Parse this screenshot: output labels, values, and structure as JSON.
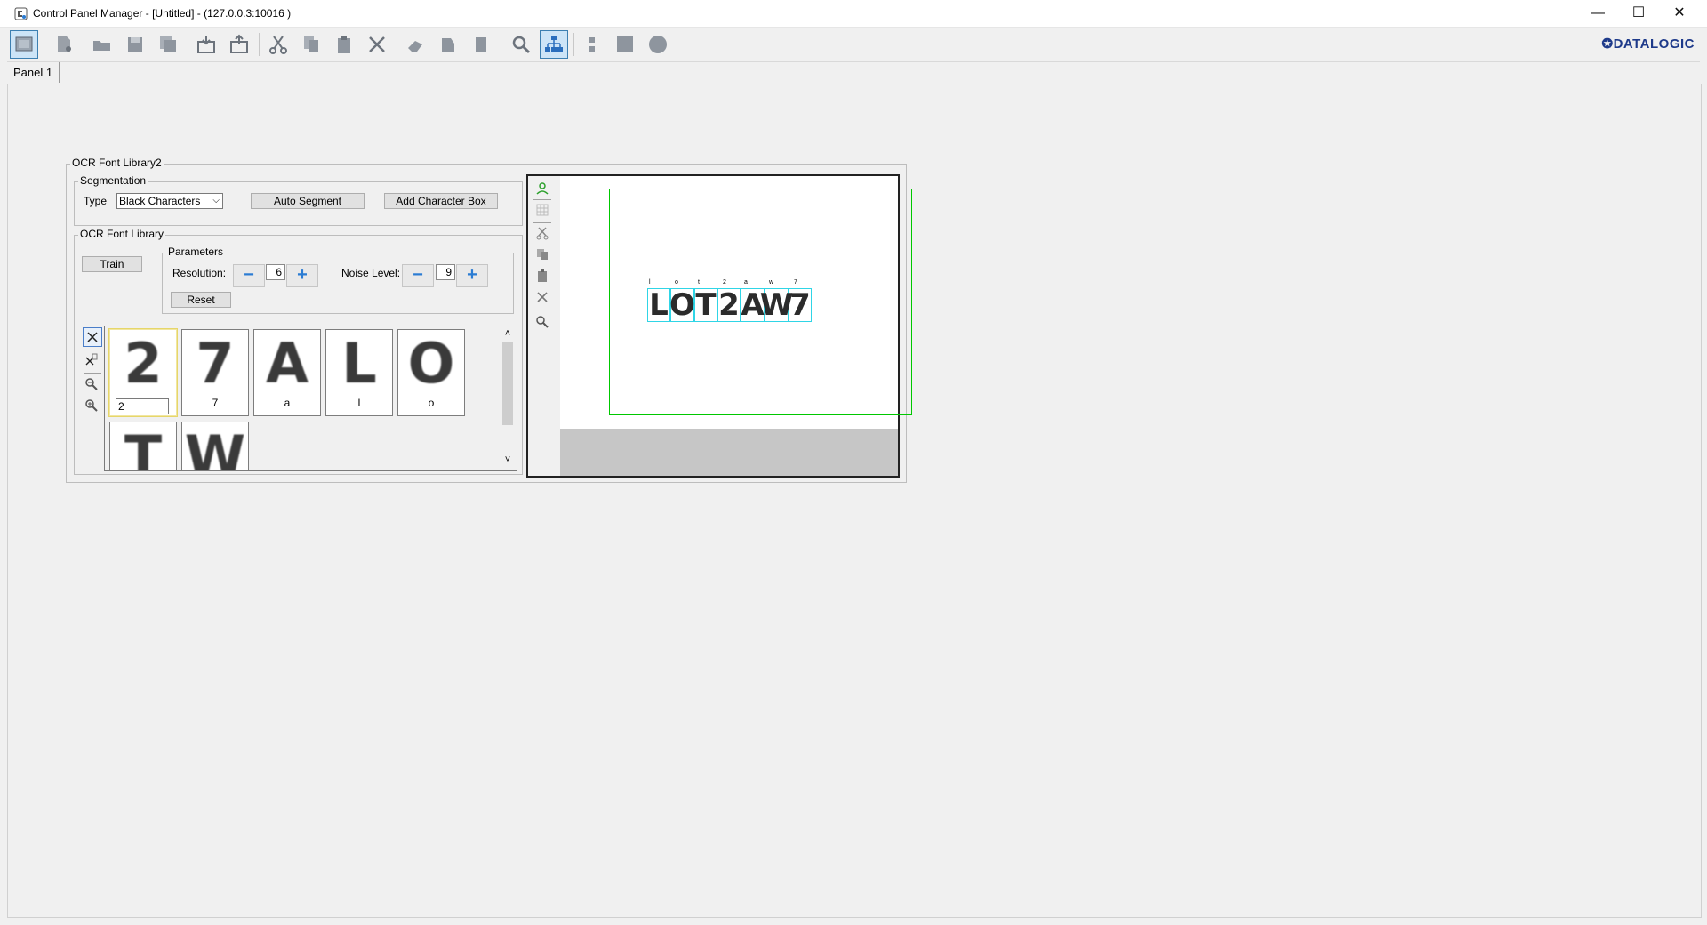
{
  "window": {
    "title": "Control Panel Manager - [Untitled] - (127.0.0.3:10016 )",
    "minimize": "—",
    "maximize": "☐",
    "close": "✕"
  },
  "brand": {
    "logo": "DATALOGIC",
    "logo_mark": "✪"
  },
  "toolbar": {
    "items": [
      "select-tool",
      "new-panel",
      "open",
      "save",
      "save-all",
      "import",
      "export",
      "cut",
      "copy",
      "paste",
      "delete",
      "align-left",
      "align-right",
      "align-bottom",
      "zoom",
      "hierarchy",
      "stack",
      "rectangle",
      "circle"
    ],
    "active": [
      "select-tool",
      "hierarchy"
    ]
  },
  "tabs": [
    {
      "label": "Panel 1"
    }
  ],
  "ocr_panel": {
    "title": "OCR Font Library2",
    "segmentation": {
      "legend": "Segmentation",
      "type_label": "Type",
      "type_value": "Black Characters",
      "auto_segment": "Auto Segment",
      "add_character_box": "Add Character Box"
    },
    "library": {
      "legend": "OCR Font Library",
      "train": "Train",
      "parameters": {
        "legend": "Parameters",
        "resolution_label": "Resolution:",
        "resolution_value": "6",
        "noise_label": "Noise Level:",
        "noise_value": "9",
        "minus": "−",
        "plus": "+",
        "reset": "Reset"
      },
      "characters": [
        {
          "glyph": "2",
          "label": "2",
          "selected": true
        },
        {
          "glyph": "7",
          "label": "7"
        },
        {
          "glyph": "A",
          "label": "a"
        },
        {
          "glyph": "L",
          "label": "l"
        },
        {
          "glyph": "O",
          "label": "o"
        },
        {
          "glyph": "T",
          "label": ""
        },
        {
          "glyph": "W",
          "label": ""
        }
      ],
      "scroll_up": "˄",
      "scroll_down": "˅"
    },
    "viewer": {
      "ocr_string": [
        "L",
        "O",
        "T",
        "2",
        "A",
        "W",
        "7"
      ],
      "tags": [
        "l",
        "o",
        "t",
        "2",
        "a",
        "w",
        "7"
      ]
    }
  }
}
